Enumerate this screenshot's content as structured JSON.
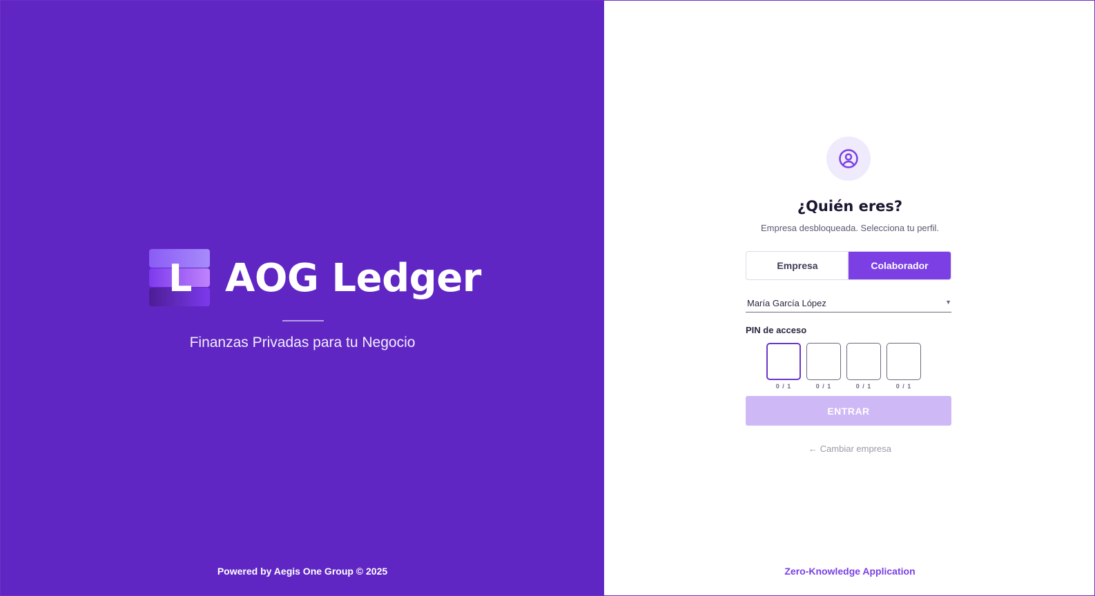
{
  "left_panel": {
    "logo_letter": "L",
    "brand_name": "AOG Ledger",
    "tagline": "Finanzas Privadas para tu Negocio",
    "footer": "Powered by Aegis One Group © 2025",
    "background_color": "#6026c4"
  },
  "right_panel": {
    "avatar_icon": "user-circle-icon",
    "title": "¿Quién eres?",
    "subtitle": "Empresa desbloqueada. Selecciona tu perfil.",
    "toggle": {
      "options": [
        {
          "label": "Empresa",
          "active": false
        },
        {
          "label": "Colaborador",
          "active": true
        }
      ],
      "accent_color": "#7b3fe4"
    },
    "profile_select": {
      "value": "María García López"
    },
    "pin": {
      "label": "PIN de acceso",
      "boxes": [
        {
          "counter": "0 / 1"
        },
        {
          "counter": "0 / 1"
        },
        {
          "counter": "0 / 1"
        },
        {
          "counter": "0 / 1"
        }
      ]
    },
    "enter_button": "ENTRAR",
    "change_company_link": "← Cambiar empresa",
    "footer_link": "Zero-Knowledge Application"
  }
}
